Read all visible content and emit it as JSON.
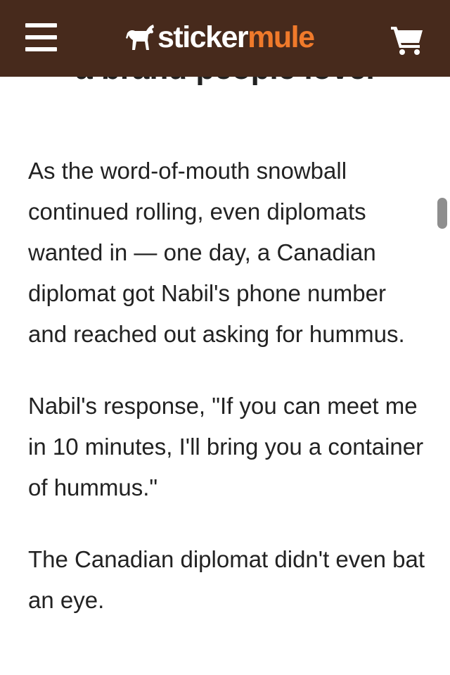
{
  "header": {
    "logo_text_light": "sticker",
    "logo_text_accent": "mule",
    "logo_icon": "mule-icon",
    "menu_icon": "hamburger-menu-icon",
    "cart_icon": "shopping-cart-icon",
    "background_color": "#472a1c",
    "accent_color": "#f07a2b"
  },
  "article": {
    "clipped_heading": "a brand people love.",
    "paragraphs": [
      "As the word-of-mouth snowball continued rolling, even diplomats wanted in — one day, a Canadian diplomat got Nabil's phone number and reached out asking for hummus.",
      "Nabil's response, \"If you can meet me in 10 minutes, I'll bring you a container of hummus.\"",
      "The Canadian diplomat didn't even bat an eye."
    ]
  }
}
